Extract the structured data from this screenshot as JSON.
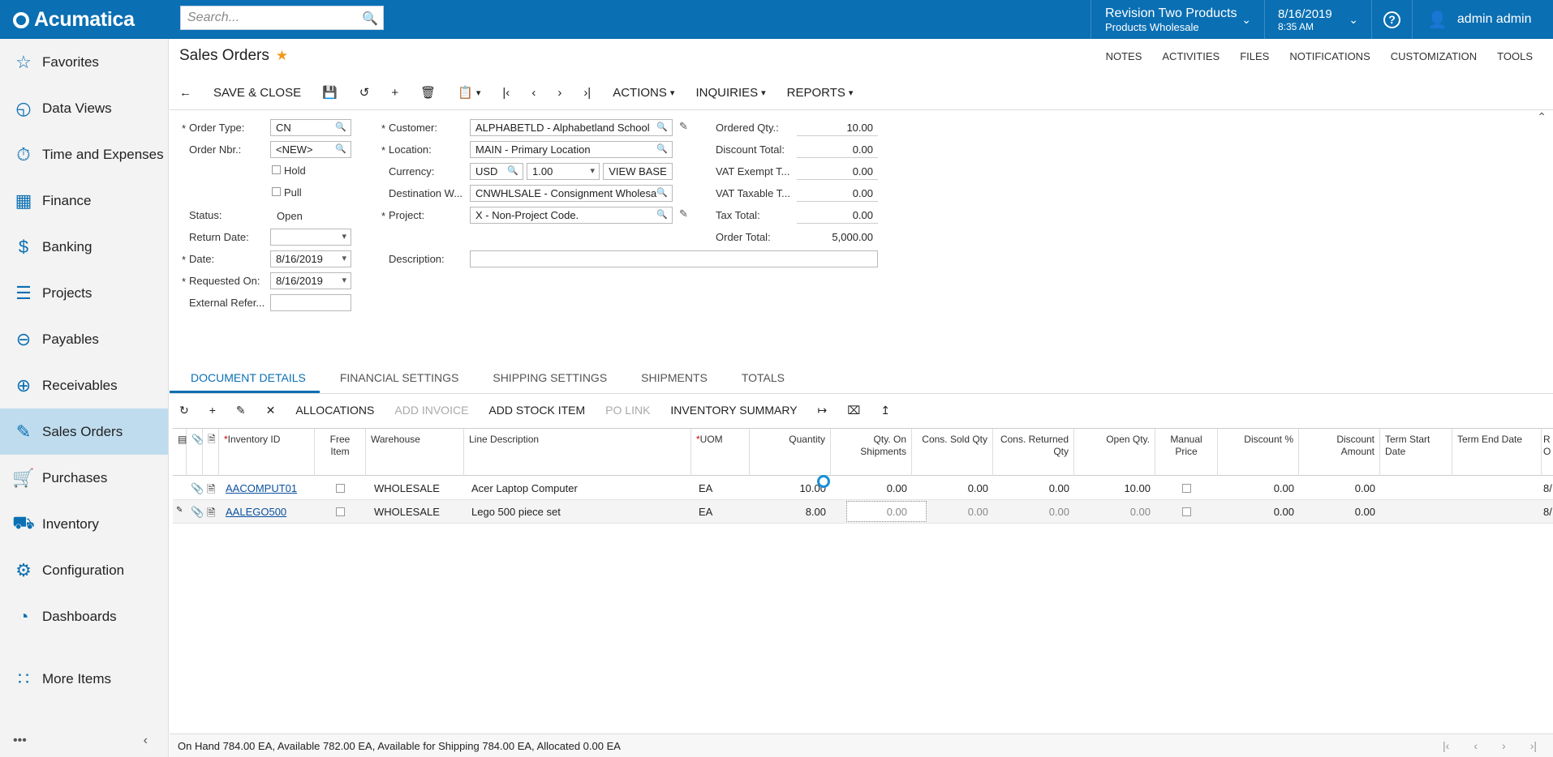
{
  "app": {
    "logo_text": "Acumatica"
  },
  "search": {
    "placeholder": "Search..."
  },
  "topbar": {
    "branch_line1": "Revision Two Products",
    "branch_line2": "Products Wholesale",
    "date": "8/16/2019",
    "time": "8:35 AM",
    "user": "admin admin",
    "help": "?"
  },
  "sidebar": {
    "items": [
      {
        "label": "Favorites",
        "icon": "star-icon"
      },
      {
        "label": "Data Views",
        "icon": "data-views-icon"
      },
      {
        "label": "Time and Expenses",
        "icon": "stopwatch-icon"
      },
      {
        "label": "Finance",
        "icon": "calculator-icon"
      },
      {
        "label": "Banking",
        "icon": "dollar-icon"
      },
      {
        "label": "Projects",
        "icon": "projects-icon"
      },
      {
        "label": "Payables",
        "icon": "minus-circle-icon"
      },
      {
        "label": "Receivables",
        "icon": "plus-circle-icon"
      },
      {
        "label": "Sales Orders",
        "icon": "pencil-icon"
      },
      {
        "label": "Purchases",
        "icon": "cart-icon"
      },
      {
        "label": "Inventory",
        "icon": "truck-icon"
      },
      {
        "label": "Configuration",
        "icon": "gear-icon"
      },
      {
        "label": "Dashboards",
        "icon": "gauge-icon"
      },
      {
        "label": "More Items",
        "icon": "grid-dots-icon"
      }
    ],
    "active": "Sales Orders"
  },
  "page": {
    "title": "Sales Orders",
    "top_links": [
      "NOTES",
      "ACTIVITIES",
      "FILES",
      "NOTIFICATIONS",
      "CUSTOMIZATION",
      "TOOLS"
    ]
  },
  "toolbar": {
    "save_close": "SAVE & CLOSE",
    "actions": "ACTIONS",
    "inquiries": "INQUIRIES",
    "reports": "REPORTS"
  },
  "form": {
    "order_type_label": "Order Type:",
    "order_type": "CN",
    "order_nbr_label": "Order Nbr.:",
    "order_nbr": "<NEW>",
    "hold_label": "Hold",
    "pull_label": "Pull",
    "status_label": "Status:",
    "status": "Open",
    "return_date_label": "Return Date:",
    "return_date": "",
    "date_label": "Date:",
    "date": "8/16/2019",
    "requested_on_label": "Requested On:",
    "requested_on": "8/16/2019",
    "external_ref_label": "External Refer...",
    "external_ref": "",
    "customer_label": "Customer:",
    "customer": "ALPHABETLD - Alphabetland School",
    "location_label": "Location:",
    "location": "MAIN - Primary Location",
    "currency_label": "Currency:",
    "currency": "USD",
    "rate": "1.00",
    "view_base": "VIEW BASE",
    "dest_wh_label": "Destination W...",
    "dest_wh": "CNWHLSALE - Consignment Wholesa",
    "project_label": "Project:",
    "project": "X - Non-Project Code.",
    "description_label": "Description:",
    "description": "",
    "ordered_qty_label": "Ordered Qty.:",
    "ordered_qty": "10.00",
    "discount_total_label": "Discount Total:",
    "discount_total": "0.00",
    "vat_exempt_label": "VAT Exempt T...",
    "vat_exempt": "0.00",
    "vat_taxable_label": "VAT Taxable T...",
    "vat_taxable": "0.00",
    "tax_total_label": "Tax Total:",
    "tax_total": "0.00",
    "order_total_label": "Order Total:",
    "order_total": "5,000.00"
  },
  "tabs": [
    "DOCUMENT DETAILS",
    "FINANCIAL SETTINGS",
    "SHIPPING SETTINGS",
    "SHIPMENTS",
    "TOTALS"
  ],
  "gridbar": {
    "allocations": "ALLOCATIONS",
    "add_invoice": "ADD INVOICE",
    "add_stock_item": "ADD STOCK ITEM",
    "po_link": "PO LINK",
    "inventory_summary": "INVENTORY SUMMARY"
  },
  "grid": {
    "headers": {
      "inventory_id": "Inventory ID",
      "free_item": "Free Item",
      "warehouse": "Warehouse",
      "line_description": "Line Description",
      "uom": "UOM",
      "quantity": "Quantity",
      "qty_on_shipments": "Qty. On Shipments",
      "cons_sold_qty": "Cons. Sold Qty",
      "cons_returned_qty": "Cons. Returned Qty",
      "open_qty": "Open Qty.",
      "manual_price": "Manual Price",
      "discount_pct": "Discount %",
      "discount_amount": "Discount Amount",
      "term_start": "Term Start Date",
      "term_end": "Term End Date",
      "last_col": "R O"
    },
    "rows": [
      {
        "inventory_id": "AACOMPUT01",
        "warehouse": "WHOLESALE",
        "description": "Acer Laptop Computer",
        "uom": "EA",
        "quantity": "10.00",
        "qty_on_shipments": "0.00",
        "cons_sold": "0.00",
        "cons_returned": "0.00",
        "open_qty": "10.00",
        "discount_pct": "0.00",
        "discount_amount": "0.00",
        "last": "8/"
      },
      {
        "inventory_id": "AALEGO500",
        "warehouse": "WHOLESALE",
        "description": "Lego 500 piece set",
        "uom": "EA",
        "quantity": "8.00",
        "qty_on_shipments": "0.00",
        "cons_sold": "0.00",
        "cons_returned": "0.00",
        "open_qty": "0.00",
        "discount_pct": "0.00",
        "discount_amount": "0.00",
        "last": "8/"
      }
    ]
  },
  "status": {
    "text": "On Hand 784.00 EA, Available 782.00 EA, Available for Shipping 784.00 EA, Allocated 0.00 EA"
  }
}
